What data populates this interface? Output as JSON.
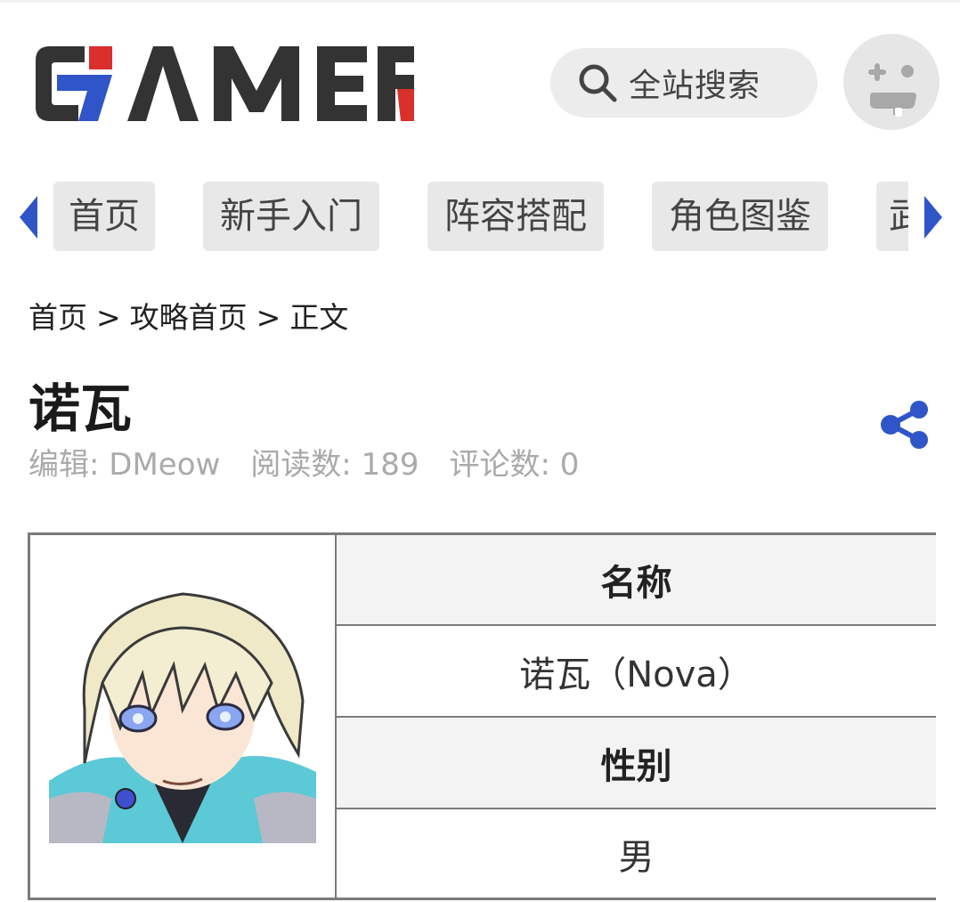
{
  "header": {
    "logo_text": "GAMER",
    "search_placeholder": "全站搜索",
    "icons": {
      "search": "search-icon",
      "avatar": "user-avatar-icon",
      "share": "share-icon"
    }
  },
  "nav": {
    "tabs": [
      {
        "label": "首页"
      },
      {
        "label": "新手入门"
      },
      {
        "label": "阵容搭配"
      },
      {
        "label": "角色图鉴"
      },
      {
        "label": "武"
      }
    ]
  },
  "breadcrumb": {
    "items": [
      "首页",
      "攻略首页",
      "正文"
    ],
    "separator": ">"
  },
  "article": {
    "title": "诺瓦",
    "editor": "编辑: DMeow",
    "reads": "阅读数: 189",
    "comments": "评论数: 0"
  },
  "info_table": {
    "rows": [
      {
        "header": "名称",
        "value": "诺瓦（Nova）"
      },
      {
        "header": "性别",
        "value": "男"
      }
    ]
  },
  "colors": {
    "logo_dark": "#333333",
    "logo_blue": "#2f55c8",
    "logo_red": "#d9302b",
    "accent_blue": "#2f55c8",
    "tab_bg": "#e8e8e8"
  }
}
